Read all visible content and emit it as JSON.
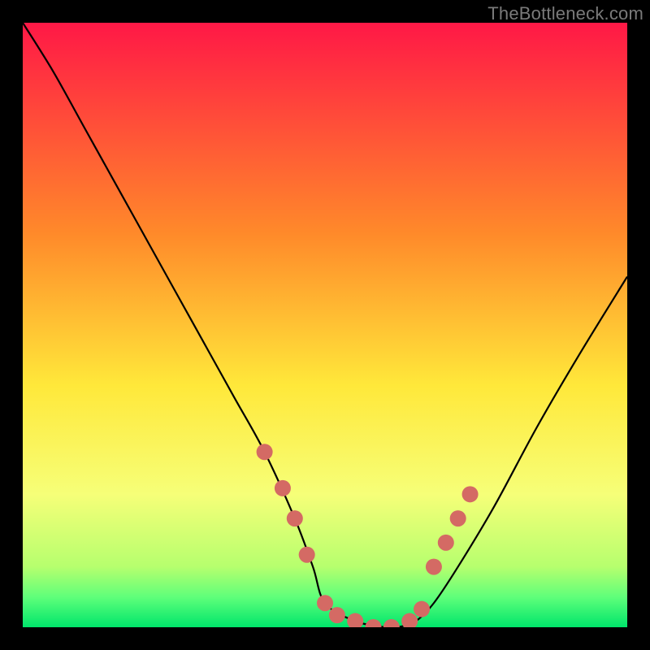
{
  "watermark": "TheBottleneck.com",
  "chart_data": {
    "type": "line",
    "title": "",
    "xlabel": "",
    "ylabel": "",
    "xlim": [
      0,
      100
    ],
    "ylim": [
      0,
      100
    ],
    "grid": false,
    "legend": false,
    "gradient_stops": [
      {
        "offset": 0,
        "color": "#ff1846"
      },
      {
        "offset": 35,
        "color": "#ff8a2a"
      },
      {
        "offset": 60,
        "color": "#ffe83a"
      },
      {
        "offset": 78,
        "color": "#f6ff78"
      },
      {
        "offset": 90,
        "color": "#b6ff6e"
      },
      {
        "offset": 95,
        "color": "#5fff7a"
      },
      {
        "offset": 100,
        "color": "#00e56b"
      }
    ],
    "series": [
      {
        "name": "bottleneck-curve",
        "x": [
          0,
          5,
          10,
          15,
          20,
          25,
          30,
          35,
          40,
          45,
          48,
          50,
          55,
          60,
          62,
          65,
          68,
          72,
          78,
          85,
          92,
          100
        ],
        "y": [
          100,
          92,
          83,
          74,
          65,
          56,
          47,
          38,
          29,
          18,
          10,
          4,
          1,
          0,
          0,
          1,
          4,
          10,
          20,
          33,
          45,
          58
        ]
      }
    ],
    "markers": {
      "name": "highlight-dots",
      "color": "#d46a64",
      "radius": 10,
      "points": [
        {
          "x": 40,
          "y": 29
        },
        {
          "x": 43,
          "y": 23
        },
        {
          "x": 45,
          "y": 18
        },
        {
          "x": 47,
          "y": 12
        },
        {
          "x": 50,
          "y": 4
        },
        {
          "x": 52,
          "y": 2
        },
        {
          "x": 55,
          "y": 1
        },
        {
          "x": 58,
          "y": 0
        },
        {
          "x": 61,
          "y": 0
        },
        {
          "x": 64,
          "y": 1
        },
        {
          "x": 66,
          "y": 3
        },
        {
          "x": 68,
          "y": 10
        },
        {
          "x": 70,
          "y": 14
        },
        {
          "x": 72,
          "y": 18
        },
        {
          "x": 74,
          "y": 22
        }
      ]
    }
  }
}
